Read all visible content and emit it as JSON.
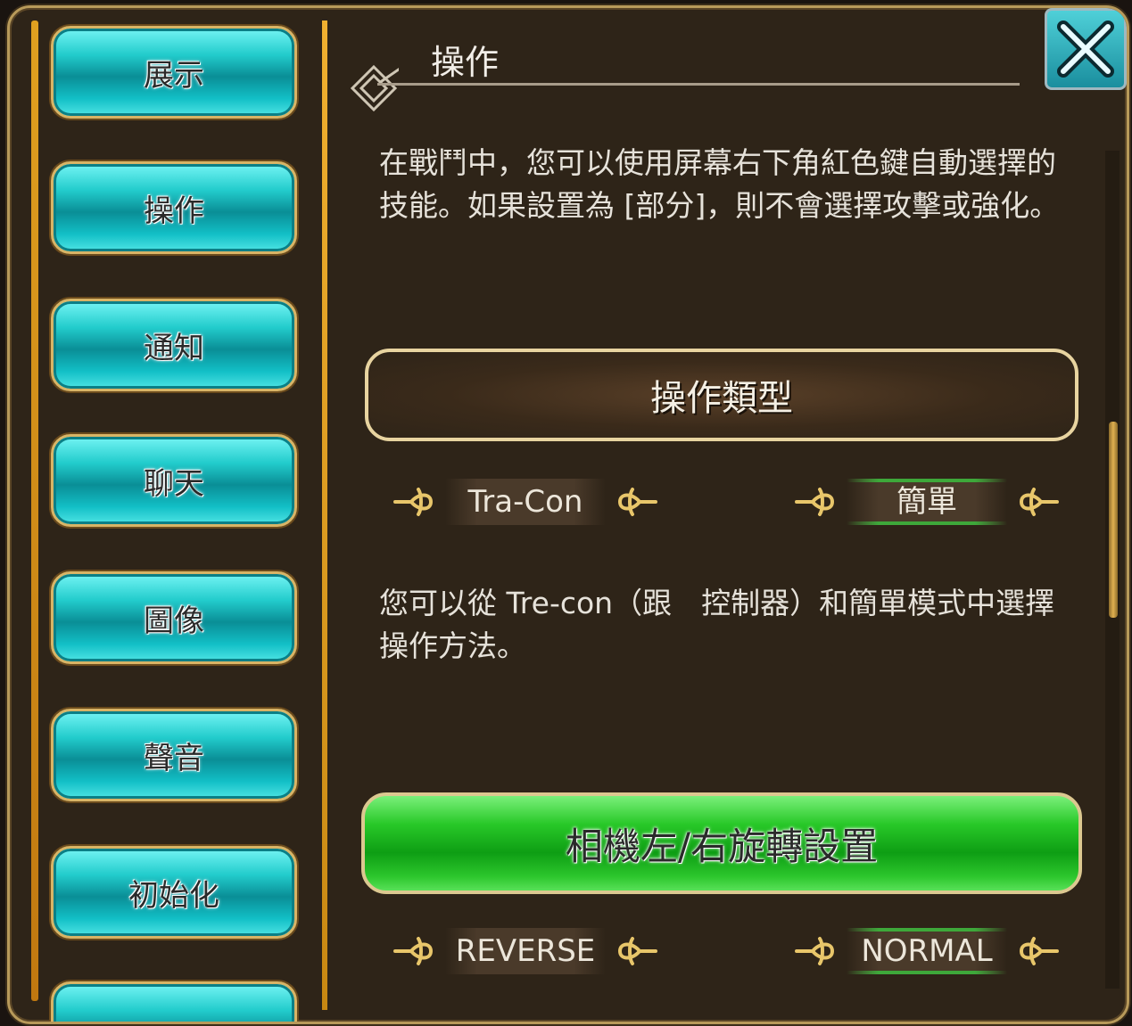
{
  "sidebar": {
    "items": [
      {
        "label": "展示"
      },
      {
        "label": "操作"
      },
      {
        "label": "通知"
      },
      {
        "label": "聊天"
      },
      {
        "label": "圖像"
      },
      {
        "label": "聲音"
      },
      {
        "label": "初始化"
      }
    ]
  },
  "header": {
    "title": "操作"
  },
  "content": {
    "intro_text": "在戰鬥中，您可以使用屏幕右下角紅色鍵自動選擇的技能。如果設置為 [部分]，則不會選擇攻擊或強化。",
    "operation_type": {
      "heading": "操作類型",
      "options": [
        "Tra-Con",
        "簡單"
      ],
      "selected": "簡單",
      "description": "您可以從 Tre-con（跟　控制器）和簡單模式中選擇操作方法。"
    },
    "camera": {
      "button_label": "相機左/右旋轉設置",
      "options": [
        "REVERSE",
        "NORMAL"
      ],
      "selected": "NORMAL"
    }
  },
  "colors": {
    "panel_bg": "#2e2418",
    "teal_button": "#22cccc",
    "green_button": "#28c828",
    "gold_trim": "#e0a020",
    "selected_underline": "#3ea83a"
  },
  "icons": {
    "close": "close-icon",
    "ornament": "fleur-ornament-icon",
    "emblem": "title-emblem-icon"
  }
}
